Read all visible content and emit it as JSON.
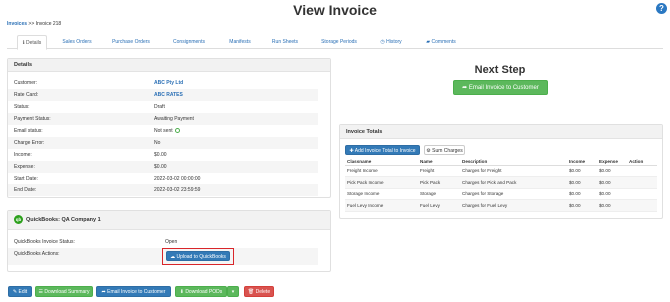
{
  "page": {
    "title": "View Invoice"
  },
  "breadcrumb": {
    "root": "Invoices",
    "sep": ">>",
    "current": "Invoice 218"
  },
  "tabs": [
    {
      "label": "Details",
      "icon": "info-icon"
    },
    {
      "label": "Sales Orders"
    },
    {
      "label": "Purchase Orders"
    },
    {
      "label": "Consignments"
    },
    {
      "label": "Manifests"
    },
    {
      "label": "Run Sheets"
    },
    {
      "label": "Storage Periods"
    },
    {
      "label": "History",
      "icon": "clock-icon"
    },
    {
      "label": "Comments",
      "icon": "comment-icon"
    }
  ],
  "details": {
    "heading": "Details",
    "rows": [
      {
        "label": "Customer:",
        "value": "ABC Pty Ltd"
      },
      {
        "label": "Rate Card:",
        "value": "ABC RATES"
      },
      {
        "label": "Status:",
        "value": "Draft"
      },
      {
        "label": "Payment Status:",
        "value": "Awaiting Payment"
      },
      {
        "label": "Email status:",
        "value": "Not sent"
      },
      {
        "label": "Charge Error:",
        "value": "No"
      },
      {
        "label": "Income:",
        "value": "$0.00"
      },
      {
        "label": "Expense:",
        "value": "$0.00"
      },
      {
        "label": "Start Date:",
        "value": "2022-03-02 00:00:00"
      },
      {
        "label": "End Date:",
        "value": "2022-03-02 23:59:59"
      }
    ]
  },
  "quickbooks": {
    "logo": "qb",
    "heading": "QuickBooks: QA Company 1",
    "status_label": "QuickBooks Invoice Status:",
    "status_value": "Open",
    "actions_label": "QuickBooks Actions:",
    "upload_button": "Upload to QuickBooks"
  },
  "next_step": {
    "heading": "Next Step",
    "email_button": "Email Invoice to Customer"
  },
  "invoice_totals": {
    "heading": "Invoice Totals",
    "add_button": "Add Invoice Total to Invoice",
    "sum_button": "Sum Charges",
    "columns": [
      "Classname",
      "Name",
      "Description",
      "Income",
      "Expense",
      "Action"
    ],
    "rows": [
      [
        "Freight Income",
        "Freight",
        "Charges for Freight",
        "$0.00",
        "$0.00",
        ""
      ],
      [
        "Pick Pack Income",
        "Pick Pack",
        "Charges for Pick and Pack",
        "$0.00",
        "$0.00",
        ""
      ],
      [
        "Storage Income",
        "Storage",
        "Charges for Storage",
        "$0.00",
        "$0.00",
        ""
      ],
      [
        "Fuel Levy Income",
        "Fuel Levy",
        "Charges for Fuel Levy",
        "$0.00",
        "$0.00",
        ""
      ]
    ]
  },
  "footer_buttons": {
    "edit": "Edit",
    "download_summary": "Download Summary",
    "email": "Email Invoice to Customer",
    "download_pods": "Download PODs",
    "delete": "Delete"
  },
  "colors": {
    "link": "#2a6fb5",
    "green": "#5cb85c",
    "blue": "#337ab7",
    "red": "#d9534f",
    "highlight": "#d9262a"
  }
}
